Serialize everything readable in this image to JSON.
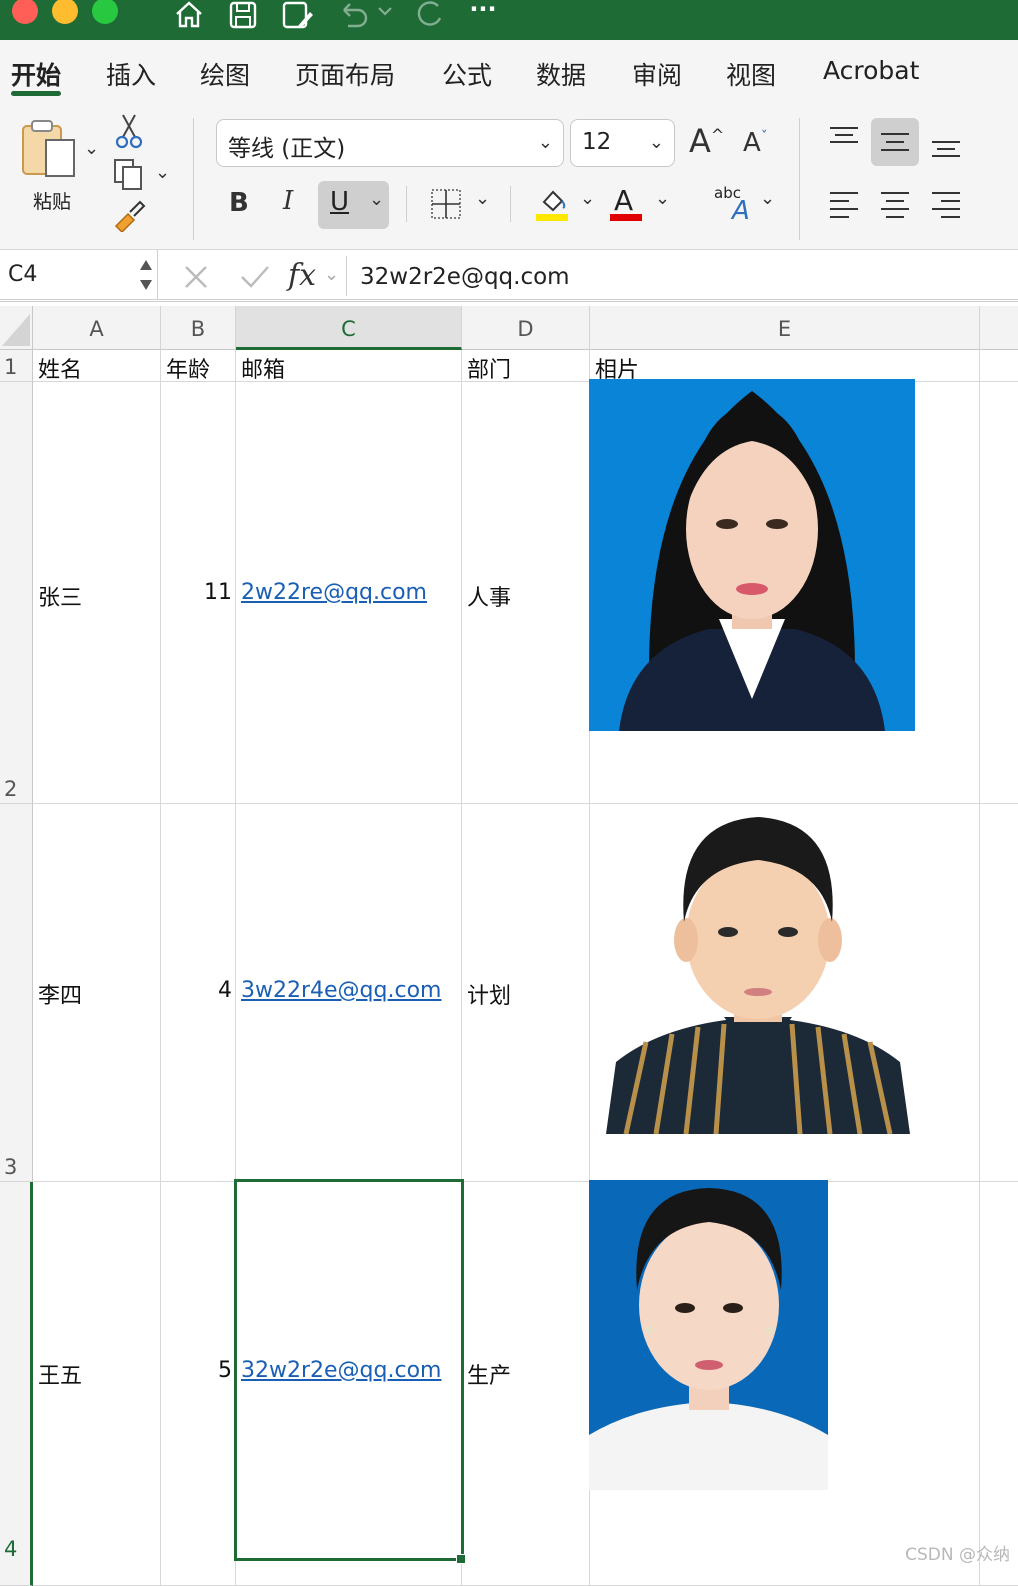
{
  "titlebar": {
    "bg": "#1e6b36",
    "icons": [
      "home-icon",
      "save-icon",
      "save-as-icon",
      "undo-icon",
      "redo-icon",
      "more-icon"
    ],
    "more_label": "···"
  },
  "ribbon_tabs": [
    "开始",
    "插入",
    "绘图",
    "页面布局",
    "公式",
    "数据",
    "审阅",
    "视图",
    "Acrobat"
  ],
  "ribbon": {
    "paste_label": "粘贴",
    "font_name": "等线 (正文)",
    "font_size": "12",
    "grow_font": "A",
    "shrink_font": "A",
    "bold": "B",
    "italic": "I",
    "underline": "U",
    "font_color_glyph": "A",
    "abc_label": "abc",
    "highlight_color": "#ffe800",
    "font_color": "#e00000"
  },
  "formula_bar": {
    "name_box": "C4",
    "fx_label": "fx",
    "value": "32w2r2e@qq.com"
  },
  "sheet": {
    "columns": [
      "A",
      "B",
      "C",
      "D",
      "E"
    ],
    "rows": [
      "1",
      "2",
      "3",
      "4"
    ],
    "header": [
      "姓名",
      "年龄",
      "邮箱",
      "部门",
      "相片"
    ],
    "data": [
      {
        "name": "张三",
        "age": "11",
        "email": "2w22re@qq.com",
        "dept": "人事",
        "photo": "woman-in-black-suit-blue-background-photo"
      },
      {
        "name": "李四",
        "age": "4",
        "email": "3w22r4e@qq.com",
        "dept": "计划",
        "photo": "boy-in-striped-shirt-white-background-photo"
      },
      {
        "name": "王五",
        "age": "5",
        "email": "32w2r2e@qq.com",
        "dept": "生产",
        "photo": "woman-in-white-top-blue-background-photo"
      }
    ],
    "selected_cell": "C4",
    "link_color": "#1a5fb4",
    "selection_color": "#1e6b36"
  },
  "watermark": "CSDN @众纳"
}
